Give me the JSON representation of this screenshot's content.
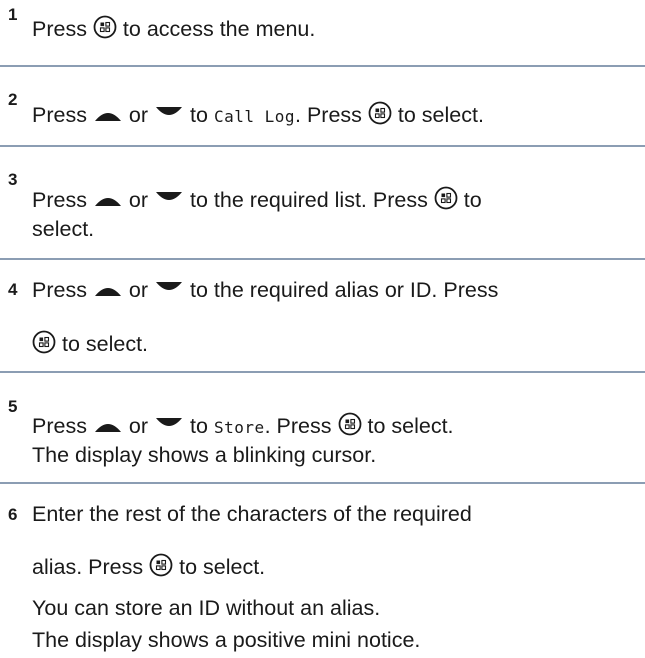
{
  "steps": [
    {
      "number": "1",
      "lines": [
        {
          "t": [
            "Press ",
            "to access the menu."
          ]
        }
      ]
    },
    {
      "number": "2",
      "lines": [
        {
          "t": [
            "Press ",
            "or",
            "to",
            "Call Log",
            ". Press",
            "to select."
          ]
        }
      ]
    },
    {
      "number": "3",
      "lines": [
        {
          "t": [
            "Press ",
            "or",
            "to the required list. Press",
            "to"
          ]
        },
        {
          "t": [
            "select."
          ]
        }
      ]
    },
    {
      "number": "4",
      "lines": [
        {
          "t": [
            "Press ",
            "or",
            "to the required alias or ID. Press"
          ]
        },
        {
          "t": [
            "to select."
          ]
        }
      ]
    },
    {
      "number": "5",
      "lines": [
        {
          "t": [
            "Press ",
            "or",
            "to",
            "Store",
            ". Press",
            "to select."
          ]
        },
        {
          "t": [
            "The display shows a blinking cursor."
          ]
        }
      ]
    },
    {
      "number": "6",
      "lines": [
        {
          "t": [
            "Enter the rest of the characters of the required"
          ]
        },
        {
          "t": [
            "alias. Press",
            "to select."
          ]
        },
        {
          "t": [
            "You can store an ID without an alias."
          ]
        },
        {
          "t": [
            "The display shows a positive mini notice."
          ]
        }
      ]
    }
  ],
  "icons": {
    "menu_ok": "menu-ok-button-icon",
    "up": "up-arrow-icon",
    "down": "down-arrow-icon"
  },
  "colors": {
    "divider": "#8b9db3",
    "text": "#1a1a1a"
  }
}
